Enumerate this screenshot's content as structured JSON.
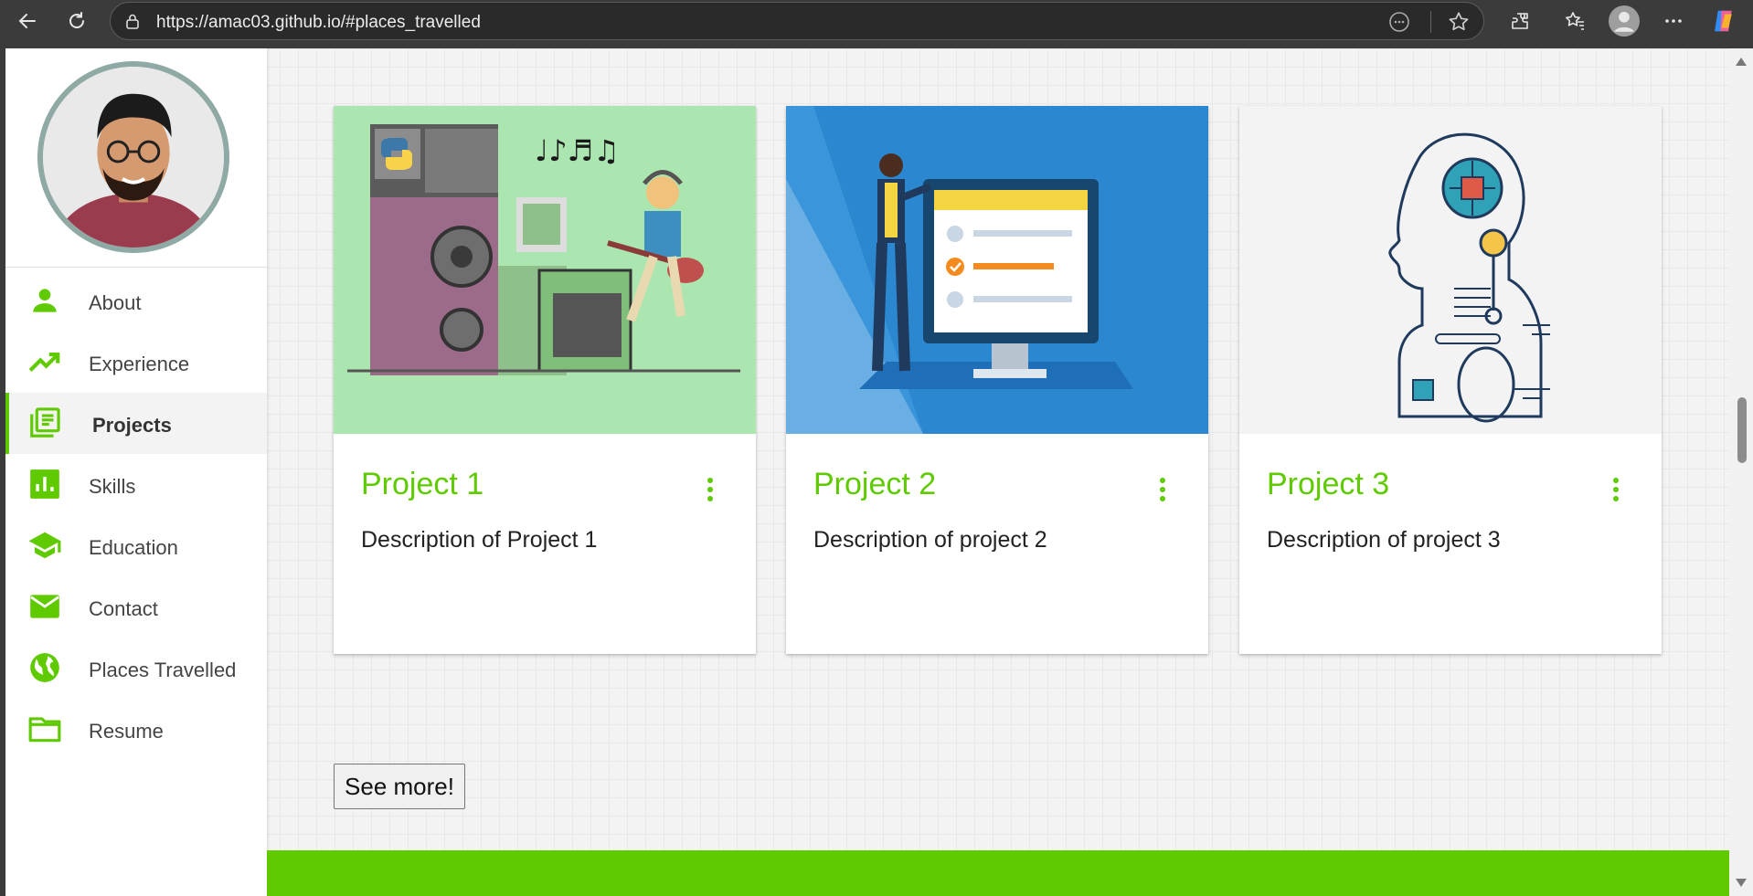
{
  "browser": {
    "url": "https://amac03.github.io/#places_travelled"
  },
  "sidebar": {
    "items": [
      {
        "label": "About",
        "icon": "person-icon"
      },
      {
        "label": "Experience",
        "icon": "trending-up-icon"
      },
      {
        "label": "Projects",
        "icon": "library-books-icon",
        "active": true
      },
      {
        "label": "Skills",
        "icon": "bar-chart-icon"
      },
      {
        "label": "Education",
        "icon": "graduation-cap-icon"
      },
      {
        "label": "Contact",
        "icon": "mail-icon"
      },
      {
        "label": "Places Travelled",
        "icon": "globe-icon"
      },
      {
        "label": "Resume",
        "icon": "folder-icon"
      }
    ]
  },
  "projects": [
    {
      "title": "Project 1",
      "description": "Description of Project 1"
    },
    {
      "title": "Project 2",
      "description": "Description of project 2"
    },
    {
      "title": "Project 3",
      "description": "Description of project 3"
    }
  ],
  "see_more_label": "See more!",
  "colors": {
    "accent": "#5fca00",
    "avatar_ring": "#8fa9a5",
    "card1_bg": "#abe6b0",
    "card2_bg": "#2b87cf",
    "card3_bg": "#f3f3f3"
  }
}
